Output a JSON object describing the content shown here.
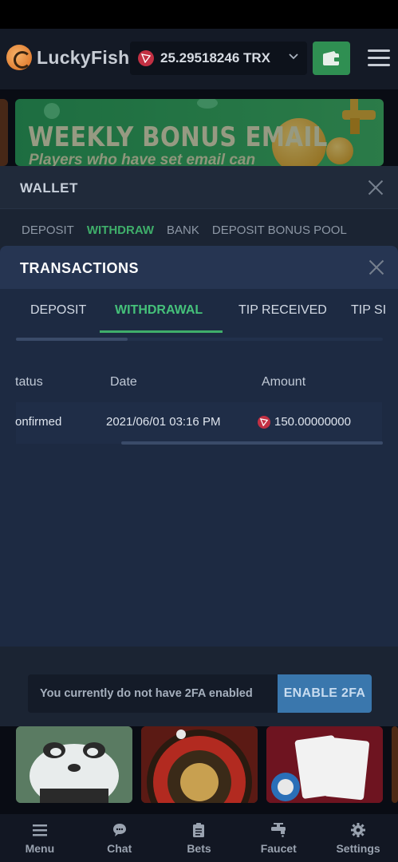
{
  "app": {
    "name": "LuckyFish"
  },
  "balance": {
    "amount": "25.29518246 TRX",
    "currency_icon": "tron-icon"
  },
  "banner": {
    "title": "WEEKLY BONUS EMAIL",
    "subtitle": "Players who have set email can"
  },
  "wallet": {
    "title": "WALLET",
    "tabs": [
      {
        "label": "DEPOSIT",
        "active": false
      },
      {
        "label": "WITHDRAW",
        "active": true
      },
      {
        "label": "BANK",
        "active": false
      },
      {
        "label": "DEPOSIT BONUS POOL",
        "active": false
      }
    ]
  },
  "transactions": {
    "title": "TRANSACTIONS",
    "tabs": [
      {
        "label": "DEPOSIT",
        "active": false
      },
      {
        "label": "WITHDRAWAL",
        "active": true
      },
      {
        "label": "TIP RECEIVED",
        "active": false
      },
      {
        "label": "TIP SI",
        "active": false
      }
    ],
    "columns": [
      "tatus",
      "Date",
      "Amount"
    ],
    "rows": [
      {
        "status": "onfirmed",
        "date": "2021/06/01 03:16 PM",
        "amount": "150.00000000"
      }
    ]
  },
  "twofa": {
    "message": "You currently do not have 2FA enabled",
    "button_label": "ENABLE 2FA"
  },
  "nav": {
    "items": [
      {
        "label": "Menu",
        "icon": "menu-icon"
      },
      {
        "label": "Chat",
        "icon": "chat-icon"
      },
      {
        "label": "Bets",
        "icon": "bets-icon"
      },
      {
        "label": "Faucet",
        "icon": "faucet-icon"
      },
      {
        "label": "Settings",
        "icon": "settings-icon"
      }
    ]
  },
  "colors": {
    "accent_green": "#3fae6a",
    "tron_red": "#c23043",
    "enable_2fa_blue": "#3a77ad"
  }
}
